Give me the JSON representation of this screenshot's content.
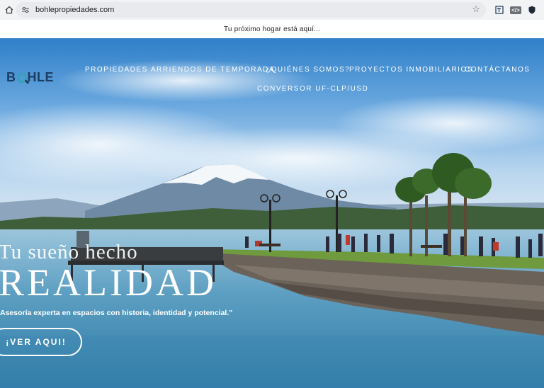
{
  "browser": {
    "url": "bohlepropiedades.com",
    "ext_badge": "</>"
  },
  "announcement": "Tu próximo hogar está aquí...",
  "logo": {
    "b": "B",
    "rest": "HLE"
  },
  "nav": {
    "items": [
      "PROPIEDADES",
      "ARRIENDOS DE TEMPORADA",
      "¿QUIÉNES SOMOS?",
      "PROYECTOS INMOBILIARIOS",
      "CONTÁCTANOS",
      "CONVERSOR UF-CLP/USD"
    ]
  },
  "hero": {
    "line1": "Tu sueño hecho",
    "line2": "REALIDAD",
    "description": "Asesoría experta en espacios con historia, identidad y potencial.\"",
    "cta": "¡VER AQUI!"
  }
}
